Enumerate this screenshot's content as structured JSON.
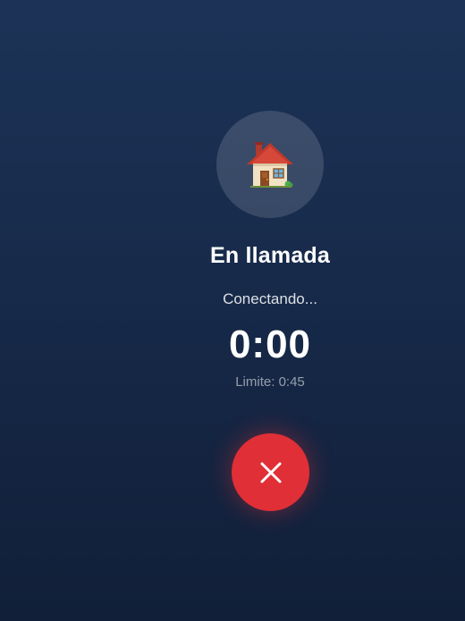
{
  "call": {
    "avatar_icon": "house-emoji-icon",
    "title": "En llamada",
    "status": "Conectando...",
    "timer": "0:00",
    "limit_label": "Limite:",
    "limit_value": "0:45",
    "hangup_icon": "close-icon"
  },
  "colors": {
    "background_top": "#1c3357",
    "background_bottom": "#111f38",
    "hangup": "#e02f36",
    "text": "#ffffff"
  }
}
